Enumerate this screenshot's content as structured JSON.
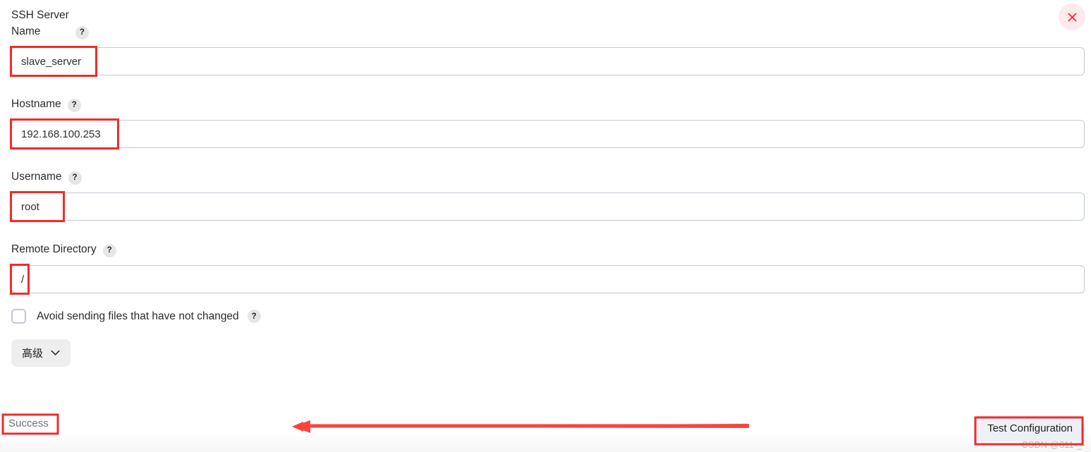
{
  "dialog": {
    "close_label": "×",
    "close_icon": "close-icon"
  },
  "fields": [
    {
      "label": "SSH Server\nName",
      "help": "?",
      "value": "slave_server",
      "placeholder": ""
    },
    {
      "label": "Hostname",
      "help": "?",
      "value": "192.168.100.253",
      "placeholder": ""
    },
    {
      "label": "Username",
      "help": "?",
      "value": "root",
      "placeholder": ""
    },
    {
      "label": "Remote Directory",
      "help": "?",
      "value": "/",
      "placeholder": ""
    }
  ],
  "checkbox": {
    "label": "Avoid sending files that have not changed",
    "help": "?",
    "checked": false
  },
  "advanced_button": {
    "label": "高级",
    "chevron_icon": "chevron-down-icon"
  },
  "footer": {
    "status": "Success",
    "test_button": "Test Configuration"
  },
  "watermark": "CSDN @611-_-",
  "colors": {
    "annotation_red": "#f42a2a",
    "input_border": "#c3cbd4",
    "status_text": "#6b6d82",
    "close_bg": "#fdeaec"
  }
}
